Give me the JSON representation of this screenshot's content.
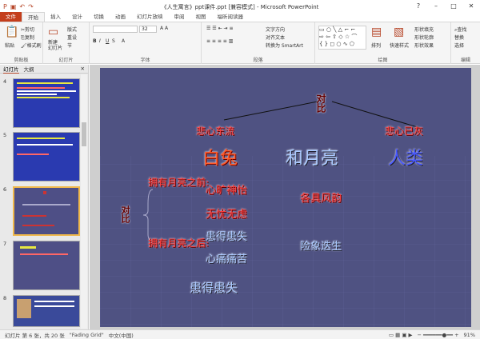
{
  "window": {
    "title": "《人生寓言》ppt课件.ppt [兼容模式] - Microsoft PowerPoint"
  },
  "tabs": [
    "文件",
    "开始",
    "插入",
    "设计",
    "切换",
    "动画",
    "幻灯片放映",
    "审阅",
    "视图",
    "福昕阅读器"
  ],
  "ribbon": {
    "paste": "粘贴",
    "cut": "剪切",
    "copy": "复制",
    "format_painter": "格式刷",
    "clipboard": "剪贴板",
    "new_slide": "新建\n幻灯片",
    "layout": "版式",
    "reset": "重设",
    "section": "节",
    "slides_group": "幻灯片",
    "font_size": "32",
    "font_group": "字体",
    "para_group": "段落",
    "text_dir": "文字方向",
    "align_text": "对齐文本",
    "smartart": "转换为 SmartArt",
    "drawing_group": "绘图",
    "arrange": "排列",
    "quick_styles": "快速样式",
    "shape_fill": "形状填充",
    "shape_outline": "形状轮廓",
    "shape_effects": "形状效果",
    "find": "查找",
    "replace": "替换",
    "select": "选择",
    "editing_group": "编辑"
  },
  "panel": {
    "tab_slides": "幻灯片",
    "tab_outline": "大纲",
    "numbers": [
      "4",
      "5",
      "6",
      "7",
      "8"
    ]
  },
  "slide": {
    "top_label": "对比",
    "left_pair_head": "悲心东流",
    "right_pair_head": "悲心已灰",
    "w1": "白兔",
    "w2": "和月亮",
    "w3": "人类",
    "branch1": "拥有月亮之前:",
    "branch2": "拥有月亮之后:",
    "side_label": "对比",
    "c1": "心旷神怡",
    "c2": "无忧无虑",
    "c3": "患得患失",
    "c4": "心痛痛苦",
    "r1": "各具风韵",
    "r2": "险象迭生",
    "bottom": "患得患失"
  },
  "status": {
    "slide": "幻灯片 第 6 张，共 20 张",
    "theme": "\"Fading Grid\"",
    "lang": "中文(中国)",
    "zoom": "91%"
  }
}
